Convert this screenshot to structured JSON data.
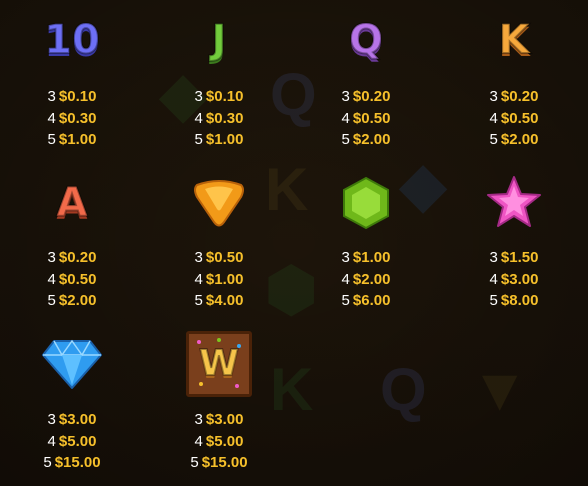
{
  "paytable": [
    {
      "symbol": "10",
      "icon": "ten-symbol-icon",
      "color": "#6b6bf0",
      "pays": [
        {
          "count": "3",
          "amount": "$0.10"
        },
        {
          "count": "4",
          "amount": "$0.30"
        },
        {
          "count": "5",
          "amount": "$1.00"
        }
      ]
    },
    {
      "symbol": "J",
      "icon": "j-symbol-icon",
      "color": "#6cc83a",
      "pays": [
        {
          "count": "3",
          "amount": "$0.10"
        },
        {
          "count": "4",
          "amount": "$0.30"
        },
        {
          "count": "5",
          "amount": "$1.00"
        }
      ]
    },
    {
      "symbol": "Q",
      "icon": "q-symbol-icon",
      "color": "#b070e0",
      "pays": [
        {
          "count": "3",
          "amount": "$0.20"
        },
        {
          "count": "4",
          "amount": "$0.50"
        },
        {
          "count": "5",
          "amount": "$2.00"
        }
      ]
    },
    {
      "symbol": "K",
      "icon": "k-symbol-icon",
      "color": "#f3a23a",
      "pays": [
        {
          "count": "3",
          "amount": "$0.20"
        },
        {
          "count": "4",
          "amount": "$0.50"
        },
        {
          "count": "5",
          "amount": "$2.00"
        }
      ]
    },
    {
      "symbol": "A",
      "icon": "a-symbol-icon",
      "color": "#f06848",
      "pays": [
        {
          "count": "3",
          "amount": "$0.20"
        },
        {
          "count": "4",
          "amount": "$0.50"
        },
        {
          "count": "5",
          "amount": "$2.00"
        }
      ]
    },
    {
      "symbol": "",
      "icon": "orange-triangle-gem-icon",
      "color": "#f5a21c",
      "pays": [
        {
          "count": "3",
          "amount": "$0.50"
        },
        {
          "count": "4",
          "amount": "$1.00"
        },
        {
          "count": "5",
          "amount": "$4.00"
        }
      ]
    },
    {
      "symbol": "",
      "icon": "green-hexagon-gem-icon",
      "color": "#7cc61e",
      "pays": [
        {
          "count": "3",
          "amount": "$1.00"
        },
        {
          "count": "4",
          "amount": "$2.00"
        },
        {
          "count": "5",
          "amount": "$6.00"
        }
      ]
    },
    {
      "symbol": "",
      "icon": "pink-star-gem-icon",
      "color": "#f05ac8",
      "pays": [
        {
          "count": "3",
          "amount": "$1.50"
        },
        {
          "count": "4",
          "amount": "$3.00"
        },
        {
          "count": "5",
          "amount": "$8.00"
        }
      ]
    },
    {
      "symbol": "",
      "icon": "blue-diamond-icon",
      "color": "#3aa7f0",
      "pays": [
        {
          "count": "3",
          "amount": "$3.00"
        },
        {
          "count": "4",
          "amount": "$5.00"
        },
        {
          "count": "5",
          "amount": "$15.00"
        }
      ]
    },
    {
      "symbol": "W",
      "icon": "wild-chocolate-icon",
      "color": "#8a4a22",
      "pays": [
        {
          "count": "3",
          "amount": "$3.00"
        },
        {
          "count": "4",
          "amount": "$5.00"
        },
        {
          "count": "5",
          "amount": "$15.00"
        }
      ]
    }
  ]
}
